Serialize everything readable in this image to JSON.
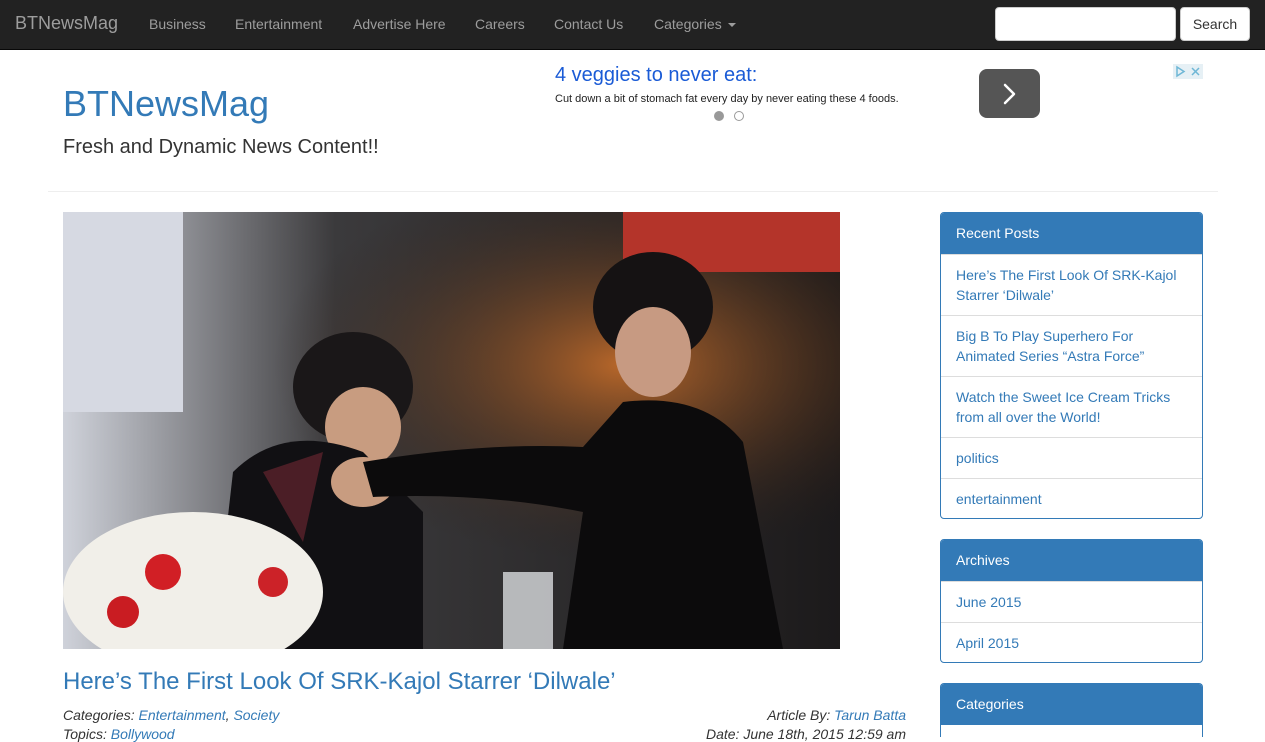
{
  "navbar": {
    "brand": "BTNewsMag",
    "items": [
      "Business",
      "Entertainment",
      "Advertise Here",
      "Careers",
      "Contact Us",
      "Categories"
    ],
    "search_button": "Search",
    "search_value": ""
  },
  "header": {
    "title": "BTNewsMag",
    "tagline": "Fresh and Dynamic News Content!!"
  },
  "ad": {
    "headline": "4 veggies to never eat:",
    "text": "Cut down a bit of stomach fat every day by never eating these 4 foods."
  },
  "post": {
    "title": "Here’s The First Look Of SRK-Kajol Starrer ‘Dilwale’",
    "categories_label": "Categories:",
    "categories": [
      "Entertainment",
      "Society"
    ],
    "topics_label": "Topics:",
    "topics": [
      "Bollywood"
    ],
    "author_label": "Article By:",
    "author": "Tarun Batta",
    "date_label": "Date:",
    "date": "June 18th, 2015 12:59 am"
  },
  "sidebar": {
    "recent_posts": {
      "heading": "Recent Posts",
      "items": [
        "Here’s The First Look Of SRK-Kajol Starrer ‘Dilwale’",
        "Big B To Play Superhero For Animated Series “Astra Force”",
        "Watch the Sweet Ice Cream Tricks from all over the World!",
        "politics",
        "entertainment"
      ]
    },
    "archives": {
      "heading": "Archives",
      "items": [
        "June 2015",
        "April 2015"
      ]
    },
    "categories": {
      "heading": "Categories"
    }
  },
  "colors": {
    "navbar_bg": "#222222",
    "link": "#337ab7",
    "panel_heading": "#337ab7"
  }
}
